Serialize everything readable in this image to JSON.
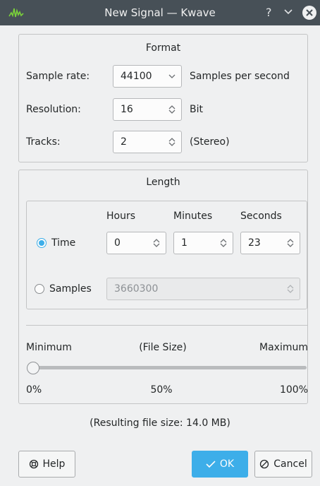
{
  "window": {
    "title": "New Signal — Kwave",
    "help_glyph": "?",
    "minimize_glyph": "⌄",
    "close_glyph": "✕"
  },
  "format": {
    "title": "Format",
    "sample_rate_label": "Sample rate:",
    "sample_rate_value": "44100",
    "sample_rate_unit": "Samples per second",
    "resolution_label": "Resolution:",
    "resolution_value": "16",
    "resolution_unit": "Bit",
    "tracks_label": "Tracks:",
    "tracks_value": "2",
    "tracks_note": "(Stereo)"
  },
  "length": {
    "title": "Length",
    "hours_header": "Hours",
    "minutes_header": "Minutes",
    "seconds_header": "Seconds",
    "time_label": "Time",
    "time_selected": true,
    "hours_value": "0",
    "minutes_value": "1",
    "seconds_value": "23",
    "samples_label": "Samples",
    "samples_value": "3660300",
    "slider_min_label": "Minimum",
    "slider_mid_label": "(File Size)",
    "slider_max_label": "Maximum",
    "slider_value_fraction": 0.0,
    "pct_0": "0%",
    "pct_50": "50%",
    "pct_100": "100%"
  },
  "result": {
    "file_size_text": "(Resulting file size: 14.0 MB)"
  },
  "buttons": {
    "help_label": "Help",
    "ok_label": "OK",
    "cancel_label": "Cancel"
  },
  "colors": {
    "accent": "#3daee9",
    "titlebar": "#475057",
    "background": "#eff0f1"
  }
}
